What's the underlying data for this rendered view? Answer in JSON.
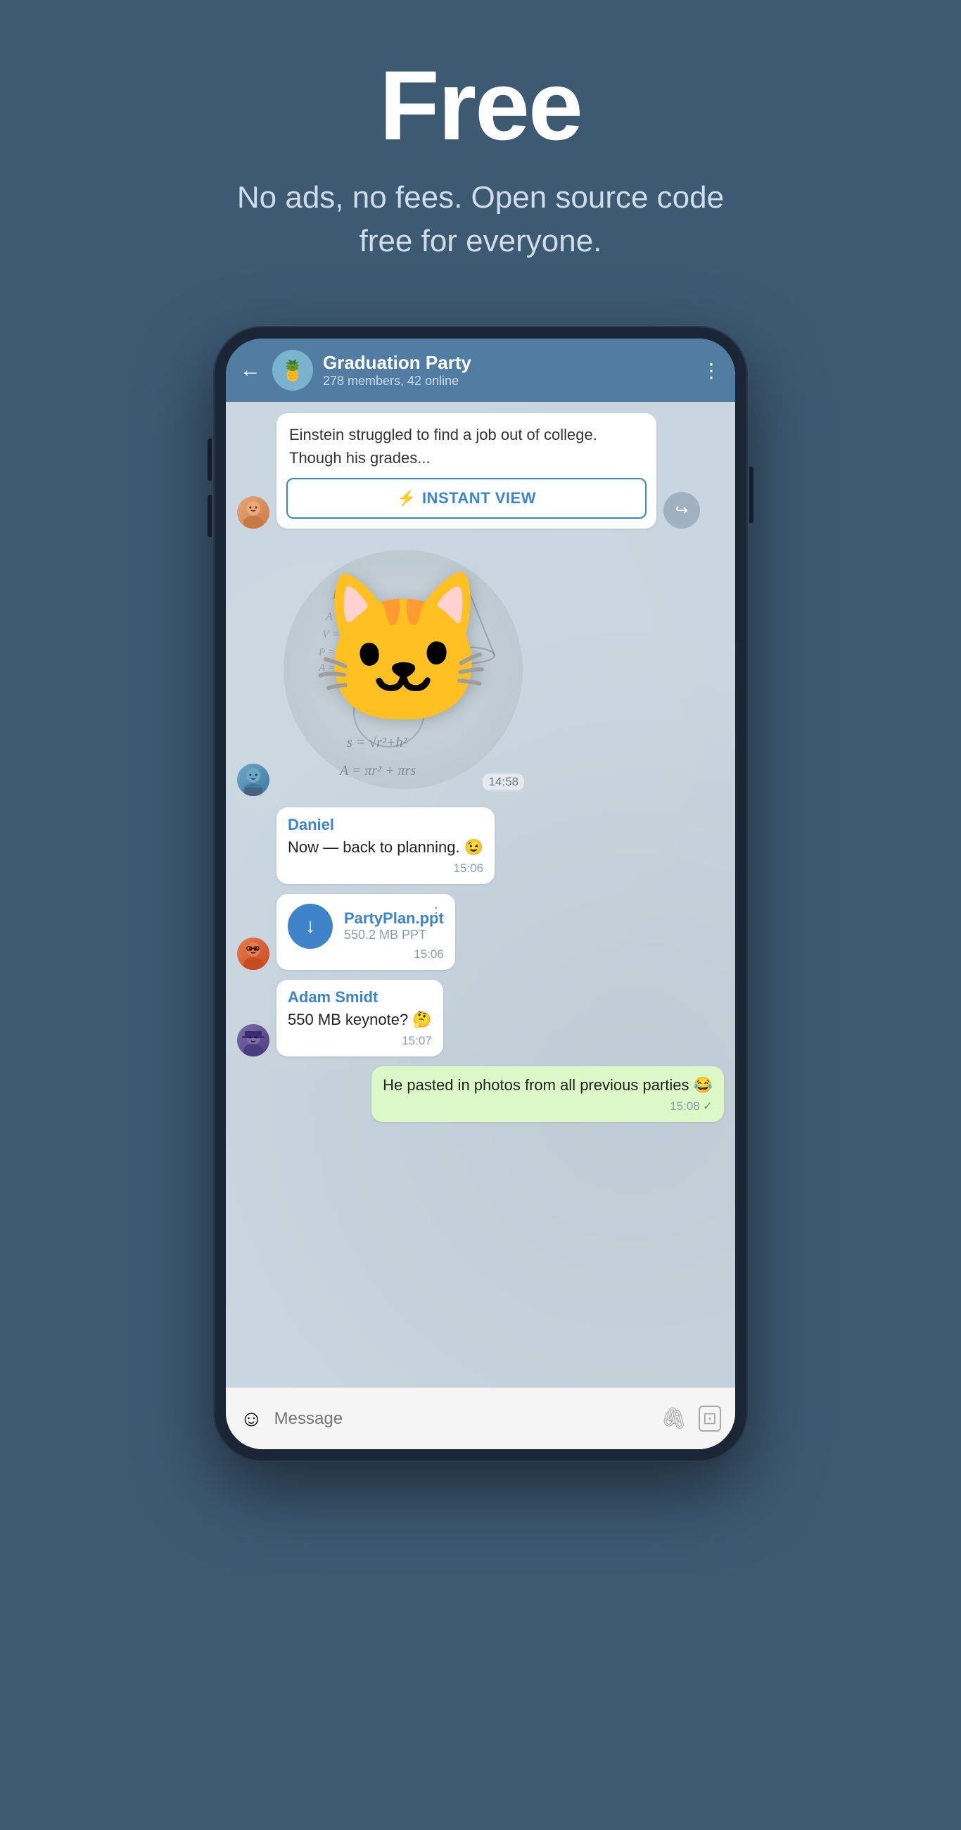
{
  "page": {
    "background_color": "#3d5a73"
  },
  "hero": {
    "title": "Free",
    "subtitle": "No ads, no fees. Open source code free for everyone."
  },
  "chat": {
    "back_label": "←",
    "group_name": "Graduation Party",
    "group_members": "278 members, 42 online",
    "menu_icon": "⋮",
    "avatar_emoji": "🍍",
    "messages": [
      {
        "id": "msg-iv",
        "type": "instant_view",
        "avatar_type": "girl",
        "text": "Einstein struggled to find a job out of college. Though his grades...",
        "iv_button_label": "INSTANT VIEW",
        "time": "",
        "side": "left"
      },
      {
        "id": "msg-sticker",
        "type": "sticker",
        "avatar_type": "guy",
        "time": "14:58",
        "side": "left"
      },
      {
        "id": "msg-daniel",
        "type": "text",
        "sender": "Daniel",
        "avatar_type": "none",
        "text": "Now — back to planning. 😉",
        "time": "15:06",
        "side": "left"
      },
      {
        "id": "msg-file",
        "type": "file",
        "avatar_type": "glasses",
        "filename": "PartyPlan.ppt",
        "filesize": "550.2 MB PPT",
        "time": "15:06",
        "side": "left"
      },
      {
        "id": "msg-adam",
        "type": "text",
        "sender": "Adam Smidt",
        "avatar_type": "hat",
        "text": "550 MB keynote? 🤔",
        "time": "15:07",
        "side": "left"
      },
      {
        "id": "msg-self",
        "type": "text",
        "sender": "",
        "avatar_type": "none",
        "text": "He pasted in photos from all previous parties 😂",
        "time": "15:08",
        "side": "right",
        "tick": true
      }
    ],
    "input": {
      "placeholder": "Message",
      "emoji_icon": "☺",
      "attach_icon": "📎",
      "camera_icon": "⊡"
    }
  }
}
